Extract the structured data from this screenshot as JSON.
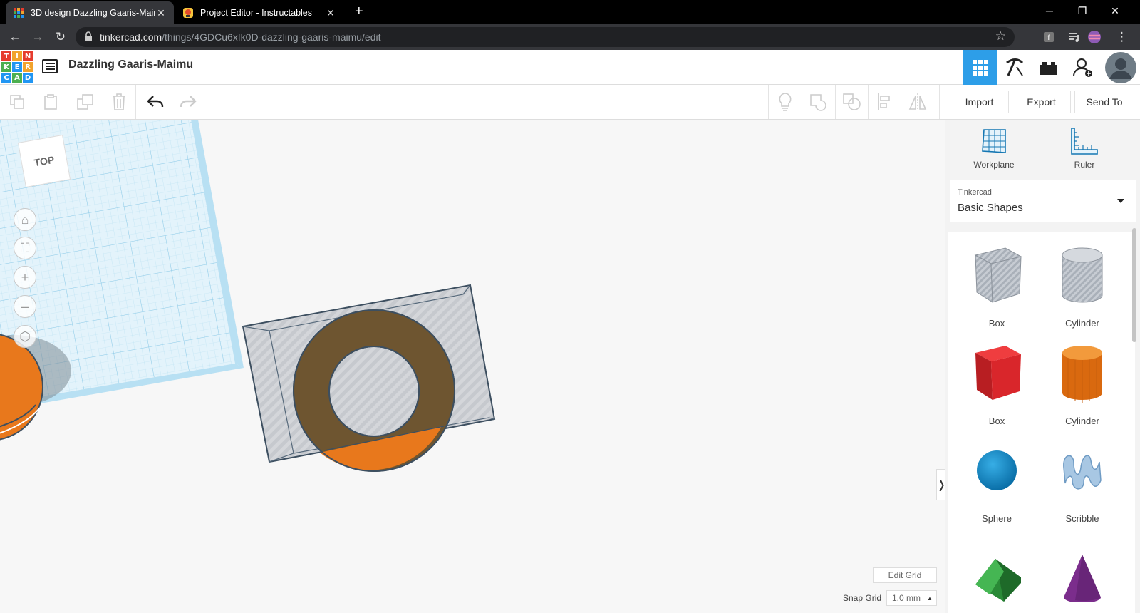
{
  "browser": {
    "tabs": [
      {
        "title": "3D design Dazzling Gaaris-Maim",
        "active": true
      },
      {
        "title": "Project Editor - Instructables",
        "active": false
      }
    ],
    "url_host": "tinkercad.com",
    "url_path": "/things/4GDCu6xIk0D-dazzling-gaaris-maimu/edit"
  },
  "logo": {
    "letters": [
      "T",
      "I",
      "N",
      "K",
      "E",
      "R",
      "C",
      "A",
      "D"
    ]
  },
  "header": {
    "title": "Dazzling Gaaris-Maimu"
  },
  "toolbar": {
    "import_label": "Import",
    "export_label": "Export",
    "sendto_label": "Send To"
  },
  "workspace": {
    "viewcube_label": "TOP",
    "edit_grid_label": "Edit Grid",
    "snap_grid_label": "Snap Grid",
    "snap_grid_value": "1.0 mm"
  },
  "panel": {
    "workplane_label": "Workplane",
    "ruler_label": "Ruler",
    "library_category": "Tinkercad",
    "library_name": "Basic Shapes",
    "shapes": [
      {
        "label": "Box",
        "color": "#b9bec6"
      },
      {
        "label": "Cylinder",
        "color": "#b9bec6"
      },
      {
        "label": "Box",
        "color": "#d9262b"
      },
      {
        "label": "Cylinder",
        "color": "#e47a1c"
      },
      {
        "label": "Sphere",
        "color": "#1a8ccc"
      },
      {
        "label": "Scribble",
        "color": "#8fb6d8"
      },
      {
        "label": "",
        "color": "#2e9c3e"
      },
      {
        "label": "",
        "color": "#7b2d8c"
      }
    ]
  },
  "colors": {
    "accent": "#2d9ee8",
    "orange": "#e8781c",
    "grid": "#bfe3f5"
  }
}
